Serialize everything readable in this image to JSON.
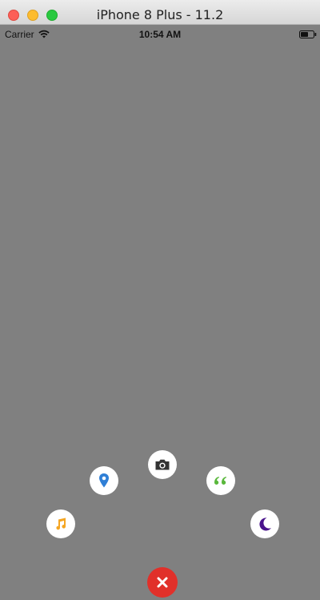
{
  "window": {
    "title": "iPhone 8 Plus - 11.2"
  },
  "status_bar": {
    "carrier": "Carrier",
    "time": "10:54 AM"
  },
  "menu": {
    "items": [
      {
        "icon": "music-note-icon",
        "color": "#f5a623"
      },
      {
        "icon": "location-pin-icon",
        "color": "#2f7fd6"
      },
      {
        "icon": "camera-icon",
        "color": "#333333"
      },
      {
        "icon": "quote-icon",
        "color": "#5ab83c"
      },
      {
        "icon": "moon-icon",
        "color": "#4a148c"
      }
    ],
    "close_button": {
      "icon": "close-icon",
      "color": "#e1302a"
    }
  }
}
